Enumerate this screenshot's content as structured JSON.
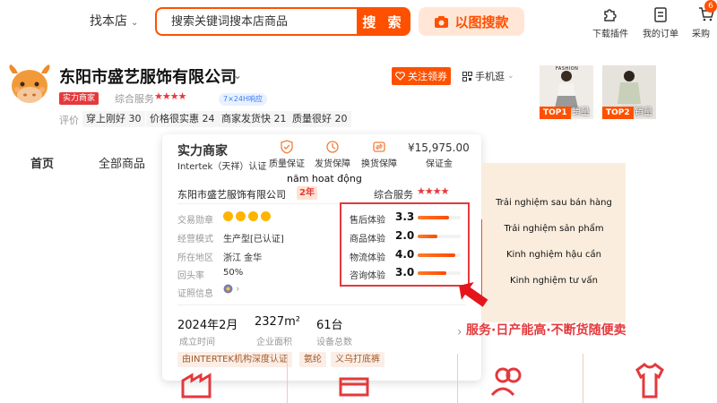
{
  "header": {
    "scope_label": "找本店",
    "search_placeholder": "搜索关键词搜本店商品",
    "search_button": "搜 索",
    "image_search_button": "以图搜款",
    "nav": [
      {
        "label": "下载插件",
        "icon": "puzzle-icon"
      },
      {
        "label": "我的订单",
        "icon": "clipboard-icon"
      },
      {
        "label": "采购",
        "icon": "cart-icon"
      }
    ],
    "cart_badge": "6"
  },
  "shop": {
    "name": "东阳市盛艺服饰有限公司",
    "strength_tag": "实力商家",
    "service_label": "综合服务",
    "service_stars": "★★★★",
    "tag_247": "7×24H响应",
    "eval_label": "评价",
    "eval_items": [
      "穿上刚好 30",
      "价格很实惠 24",
      "商家发货快 21",
      "质量很好 20"
    ],
    "follow_button": "关注领券",
    "mobile_button": "手机逛",
    "products": [
      {
        "rank": "TOP1",
        "sales": "销量",
        "brand": "FASHION"
      },
      {
        "rank": "TOP2",
        "sales": "销量"
      }
    ]
  },
  "shop_nav": [
    "首页",
    "全部商品"
  ],
  "card": {
    "title": "实力商家",
    "certifier": "Intertek（天祥）认证",
    "guarantees": [
      {
        "label": "质量保证",
        "icon": "quality-icon"
      },
      {
        "label": "发货保障",
        "icon": "delivery-icon"
      },
      {
        "label": "换货保障",
        "icon": "exchange-icon"
      }
    ],
    "deposit_value": "¥15,975.00",
    "deposit_label": "保证金",
    "company": "东阳市盛艺服饰有限公司",
    "years_tag": "2年",
    "service_label": "综合服务",
    "service_stars": "★★★★",
    "info": [
      {
        "label": "交易勋章",
        "value": ""
      },
      {
        "label": "经营模式",
        "value": "生产型[已认证]"
      },
      {
        "label": "所在地区",
        "value": "浙江 金华"
      },
      {
        "label": "回头率",
        "value": "50%"
      },
      {
        "label": "证照信息",
        "value": ""
      }
    ],
    "scores": [
      {
        "label": "售后体验",
        "value": "3.3",
        "fill": 0.72
      },
      {
        "label": "商品体验",
        "value": "2.0",
        "fill": 0.45
      },
      {
        "label": "物流体验",
        "value": "4.0",
        "fill": 0.88
      },
      {
        "label": "咨询体验",
        "value": "3.0",
        "fill": 0.66
      }
    ],
    "stats": [
      {
        "value": "2024年2月",
        "label": "成立时间"
      },
      {
        "value": "2327m²",
        "label": "企业面积"
      },
      {
        "value": "61台",
        "label": "设备总数"
      }
    ],
    "bottom_tags": [
      "由INTERTEK机构深度认证",
      "氨纶",
      "义乌打底裤"
    ]
  },
  "annotation": {
    "note_over_card": "năm hoat động",
    "lines": [
      "Trải nghiệm sau bán hàng",
      "Trải nghiệm sản phẩm",
      "Kinh nghiệm hậu cần",
      "Kinh nghiệm tư vấn"
    ]
  },
  "slogan": "服务·日产能高·不断货随便卖"
}
